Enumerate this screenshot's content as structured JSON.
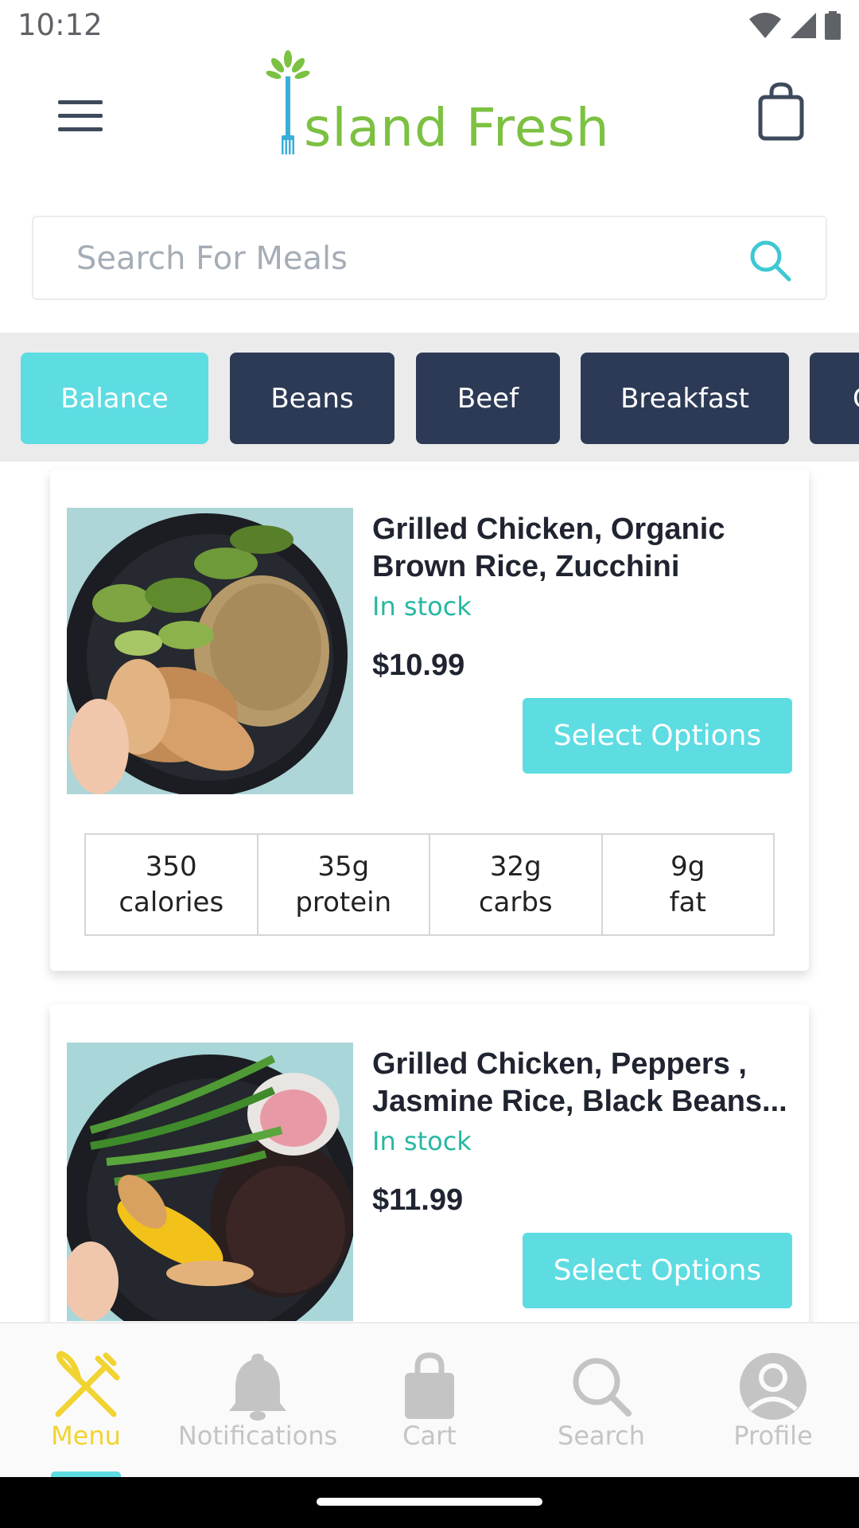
{
  "status_bar": {
    "time": "10:12"
  },
  "header": {
    "logo_text": "sland Fresh",
    "brand_colors": {
      "green": "#7cc142",
      "blue": "#3aaed8"
    }
  },
  "search": {
    "placeholder": "Search For Meals",
    "value": ""
  },
  "categories": [
    {
      "label": "Balance",
      "active": true
    },
    {
      "label": "Beans",
      "active": false
    },
    {
      "label": "Beef",
      "active": false
    },
    {
      "label": "Breakfast",
      "active": false
    },
    {
      "label": "C",
      "active": false
    }
  ],
  "products": [
    {
      "title_line1": "Grilled Chicken, Organic",
      "title_line2": "Brown Rice, Zucchini",
      "stock": "In stock",
      "price": "$10.99",
      "button_label": "Select Options",
      "nutrition": [
        {
          "value": "350",
          "unit": "calories"
        },
        {
          "value": "35g",
          "unit": "protein"
        },
        {
          "value": "32g",
          "unit": "carbs"
        },
        {
          "value": "9g",
          "unit": "fat"
        }
      ]
    },
    {
      "title_line1": "Grilled Chicken, Peppers ,",
      "title_line2": "Jasmine Rice, Black Beans...",
      "stock": "In stock",
      "price": "$11.99",
      "button_label": "Select Options"
    }
  ],
  "bottom_nav": [
    {
      "label": "Menu",
      "icon": "fork-knife-icon",
      "active": true
    },
    {
      "label": "Notifications",
      "icon": "bell-icon",
      "active": false
    },
    {
      "label": "Cart",
      "icon": "shopping-bag-icon",
      "active": false
    },
    {
      "label": "Search",
      "icon": "search-icon",
      "active": false
    },
    {
      "label": "Profile",
      "icon": "profile-icon",
      "active": false
    }
  ],
  "colors": {
    "accent": "#5ddce2",
    "navy": "#2d3a55",
    "stock_green": "#27b7a2",
    "active_nav": "#f1d332",
    "inactive_nav": "#c4c4c4"
  }
}
